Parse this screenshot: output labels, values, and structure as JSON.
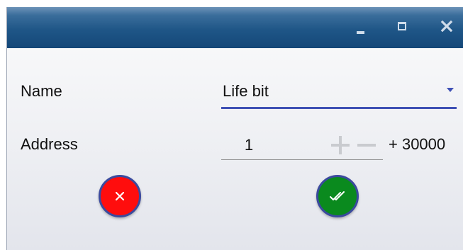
{
  "window": {
    "controls": {
      "minimize": "minimize-icon",
      "maximize": "maximize-icon",
      "close": "close-icon"
    },
    "accent_color": "#3f51b5",
    "titlebar_color": "#1f5687"
  },
  "form": {
    "name_label": "Name",
    "name_value": "Life bit",
    "address_label": "Address",
    "address_value": "1",
    "address_offset": "+ 30000"
  },
  "actions": {
    "cancel_icon": "close-icon",
    "cancel_color": "#ff0d0d",
    "confirm_icon": "double-check-icon",
    "confirm_color": "#0a8a1e"
  }
}
